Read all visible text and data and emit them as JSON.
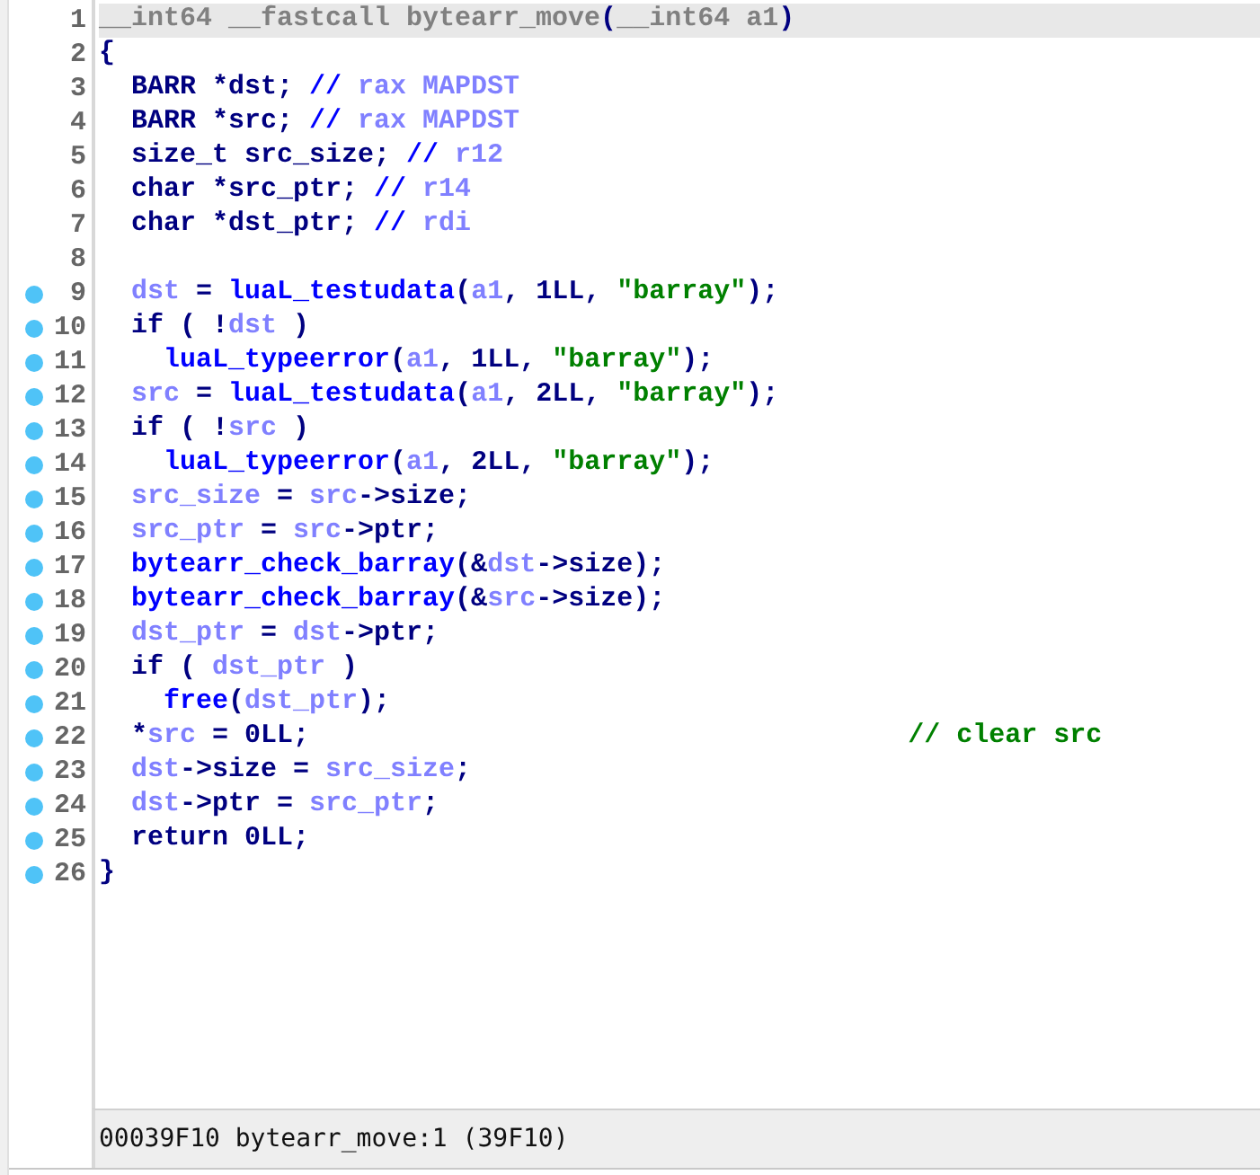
{
  "pseudocode": {
    "lines": [
      {
        "number": "1",
        "breakpoint": false,
        "highlighted": true,
        "tokens": [
          {
            "kind": "header",
            "text": "__int64 __fastcall bytearr_move"
          },
          {
            "kind": "plain",
            "text": "("
          },
          {
            "kind": "header",
            "text": "__int64 a1"
          },
          {
            "kind": "plain",
            "text": ")"
          }
        ]
      },
      {
        "number": "2",
        "breakpoint": false,
        "highlighted": false,
        "tokens": [
          {
            "kind": "plain",
            "text": "{"
          }
        ]
      },
      {
        "number": "3",
        "breakpoint": false,
        "highlighted": false,
        "tokens": [
          {
            "kind": "plain",
            "text": "  BARR *dst; "
          },
          {
            "kind": "func",
            "text": "// "
          },
          {
            "kind": "var",
            "text": "rax MAPDST"
          }
        ]
      },
      {
        "number": "4",
        "breakpoint": false,
        "highlighted": false,
        "tokens": [
          {
            "kind": "plain",
            "text": "  BARR *src; "
          },
          {
            "kind": "func",
            "text": "// "
          },
          {
            "kind": "var",
            "text": "rax MAPDST"
          }
        ]
      },
      {
        "number": "5",
        "breakpoint": false,
        "highlighted": false,
        "tokens": [
          {
            "kind": "plain",
            "text": "  size_t src_size; "
          },
          {
            "kind": "func",
            "text": "// "
          },
          {
            "kind": "var",
            "text": "r12"
          }
        ]
      },
      {
        "number": "6",
        "breakpoint": false,
        "highlighted": false,
        "tokens": [
          {
            "kind": "plain",
            "text": "  char *src_ptr; "
          },
          {
            "kind": "func",
            "text": "// "
          },
          {
            "kind": "var",
            "text": "r14"
          }
        ]
      },
      {
        "number": "7",
        "breakpoint": false,
        "highlighted": false,
        "tokens": [
          {
            "kind": "plain",
            "text": "  char *dst_ptr; "
          },
          {
            "kind": "func",
            "text": "// "
          },
          {
            "kind": "var",
            "text": "rdi"
          }
        ]
      },
      {
        "number": "8",
        "breakpoint": false,
        "highlighted": false
      },
      {
        "number": "9",
        "breakpoint": true,
        "highlighted": false,
        "tokens": [
          {
            "kind": "var",
            "text": "  dst"
          },
          {
            "kind": "plain",
            "text": " = "
          },
          {
            "kind": "func",
            "text": "luaL_testudata"
          },
          {
            "kind": "plain",
            "text": "("
          },
          {
            "kind": "var",
            "text": "a1"
          },
          {
            "kind": "plain",
            "text": ", 1LL, "
          },
          {
            "kind": "string",
            "text": "\"barray\""
          },
          {
            "kind": "plain",
            "text": ");"
          }
        ]
      },
      {
        "number": "10",
        "breakpoint": true,
        "highlighted": false,
        "tokens": [
          {
            "kind": "plain",
            "text": "  if ( !"
          },
          {
            "kind": "var",
            "text": "dst"
          },
          {
            "kind": "plain",
            "text": " )"
          }
        ]
      },
      {
        "number": "11",
        "breakpoint": true,
        "highlighted": false,
        "tokens": [
          {
            "kind": "func",
            "text": "    luaL_typeerror"
          },
          {
            "kind": "plain",
            "text": "("
          },
          {
            "kind": "var",
            "text": "a1"
          },
          {
            "kind": "plain",
            "text": ", 1LL, "
          },
          {
            "kind": "string",
            "text": "\"barray\""
          },
          {
            "kind": "plain",
            "text": ");"
          }
        ]
      },
      {
        "number": "12",
        "breakpoint": true,
        "highlighted": false,
        "tokens": [
          {
            "kind": "var",
            "text": "  src"
          },
          {
            "kind": "plain",
            "text": " = "
          },
          {
            "kind": "func",
            "text": "luaL_testudata"
          },
          {
            "kind": "plain",
            "text": "("
          },
          {
            "kind": "var",
            "text": "a1"
          },
          {
            "kind": "plain",
            "text": ", 2LL, "
          },
          {
            "kind": "string",
            "text": "\"barray\""
          },
          {
            "kind": "plain",
            "text": ");"
          }
        ]
      },
      {
        "number": "13",
        "breakpoint": true,
        "highlighted": false,
        "tokens": [
          {
            "kind": "plain",
            "text": "  if ( !"
          },
          {
            "kind": "var",
            "text": "src"
          },
          {
            "kind": "plain",
            "text": " )"
          }
        ]
      },
      {
        "number": "14",
        "breakpoint": true,
        "highlighted": false,
        "tokens": [
          {
            "kind": "func",
            "text": "    luaL_typeerror"
          },
          {
            "kind": "plain",
            "text": "("
          },
          {
            "kind": "var",
            "text": "a1"
          },
          {
            "kind": "plain",
            "text": ", 2LL, "
          },
          {
            "kind": "string",
            "text": "\"barray\""
          },
          {
            "kind": "plain",
            "text": ");"
          }
        ]
      },
      {
        "number": "15",
        "breakpoint": true,
        "highlighted": false,
        "tokens": [
          {
            "kind": "var",
            "text": "  src_size"
          },
          {
            "kind": "plain",
            "text": " = "
          },
          {
            "kind": "var",
            "text": "src"
          },
          {
            "kind": "plain",
            "text": "->size;"
          }
        ]
      },
      {
        "number": "16",
        "breakpoint": true,
        "highlighted": false,
        "tokens": [
          {
            "kind": "var",
            "text": "  src_ptr"
          },
          {
            "kind": "plain",
            "text": " = "
          },
          {
            "kind": "var",
            "text": "src"
          },
          {
            "kind": "plain",
            "text": "->ptr;"
          }
        ]
      },
      {
        "number": "17",
        "breakpoint": true,
        "highlighted": false,
        "tokens": [
          {
            "kind": "func",
            "text": "  bytearr_check_barray"
          },
          {
            "kind": "plain",
            "text": "(&"
          },
          {
            "kind": "var",
            "text": "dst"
          },
          {
            "kind": "plain",
            "text": "->size);"
          }
        ]
      },
      {
        "number": "18",
        "breakpoint": true,
        "highlighted": false,
        "tokens": [
          {
            "kind": "func",
            "text": "  bytearr_check_barray"
          },
          {
            "kind": "plain",
            "text": "(&"
          },
          {
            "kind": "var",
            "text": "src"
          },
          {
            "kind": "plain",
            "text": "->size);"
          }
        ]
      },
      {
        "number": "19",
        "breakpoint": true,
        "highlighted": false,
        "tokens": [
          {
            "kind": "var",
            "text": "  dst_ptr"
          },
          {
            "kind": "plain",
            "text": " = "
          },
          {
            "kind": "var",
            "text": "dst"
          },
          {
            "kind": "plain",
            "text": "->ptr;"
          }
        ]
      },
      {
        "number": "20",
        "breakpoint": true,
        "highlighted": false,
        "tokens": [
          {
            "kind": "plain",
            "text": "  if ( "
          },
          {
            "kind": "var",
            "text": "dst_ptr"
          },
          {
            "kind": "plain",
            "text": " )"
          }
        ]
      },
      {
        "number": "21",
        "breakpoint": true,
        "highlighted": false,
        "tokens": [
          {
            "kind": "func",
            "text": "    free"
          },
          {
            "kind": "plain",
            "text": "("
          },
          {
            "kind": "var",
            "text": "dst_ptr"
          },
          {
            "kind": "plain",
            "text": ");"
          }
        ]
      },
      {
        "number": "22",
        "breakpoint": true,
        "highlighted": false,
        "tokens": [
          {
            "kind": "plain",
            "text": "  *"
          },
          {
            "kind": "var",
            "text": "src"
          },
          {
            "kind": "plain",
            "text": " = 0LL;                                     "
          },
          {
            "kind": "comment",
            "text": "// clear src"
          }
        ]
      },
      {
        "number": "23",
        "breakpoint": true,
        "highlighted": false,
        "tokens": [
          {
            "kind": "var",
            "text": "  dst"
          },
          {
            "kind": "plain",
            "text": "->size = "
          },
          {
            "kind": "var",
            "text": "src_size"
          },
          {
            "kind": "plain",
            "text": ";"
          }
        ]
      },
      {
        "number": "24",
        "breakpoint": true,
        "highlighted": false,
        "tokens": [
          {
            "kind": "var",
            "text": "  dst"
          },
          {
            "kind": "plain",
            "text": "->ptr = "
          },
          {
            "kind": "var",
            "text": "src_ptr"
          },
          {
            "kind": "plain",
            "text": ";"
          }
        ]
      },
      {
        "number": "25",
        "breakpoint": true,
        "highlighted": false,
        "tokens": [
          {
            "kind": "plain",
            "text": "  return 0LL;"
          }
        ]
      },
      {
        "number": "26",
        "breakpoint": true,
        "highlighted": false,
        "tokens": [
          {
            "kind": "plain",
            "text": "}"
          }
        ]
      }
    ]
  },
  "status_bar": {
    "text": "00039F10 bytearr_move:1 (39F10)"
  }
}
